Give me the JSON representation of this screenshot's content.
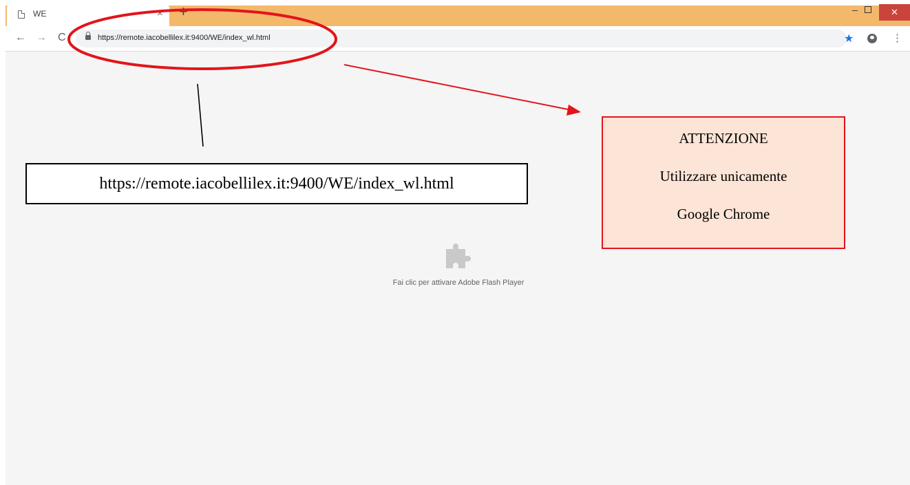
{
  "browser": {
    "tab": {
      "title": "WE",
      "close": "×"
    },
    "new_tab": "+",
    "window": {
      "minimize": "–",
      "close": "✕"
    },
    "nav": {
      "back": "←",
      "forward": "→",
      "reload": "C"
    },
    "url": "https://remote.iacobellilex.it:9400/WE/index_wl.html",
    "star": "★",
    "menu": "⋮"
  },
  "page": {
    "plugin_message": "Fai clic per attivare Adobe Flash Player"
  },
  "annotations": {
    "url_callout": "https://remote.iacobellilex.it:9400/WE/index_wl.html",
    "warning": {
      "title": "ATTENZIONE",
      "line1": "Utilizzare unicamente",
      "line2": "Google Chrome"
    },
    "colors": {
      "highlight": "#e3141b",
      "warning_bg": "#fce4d6",
      "titlebar": "#f4b86b"
    }
  }
}
